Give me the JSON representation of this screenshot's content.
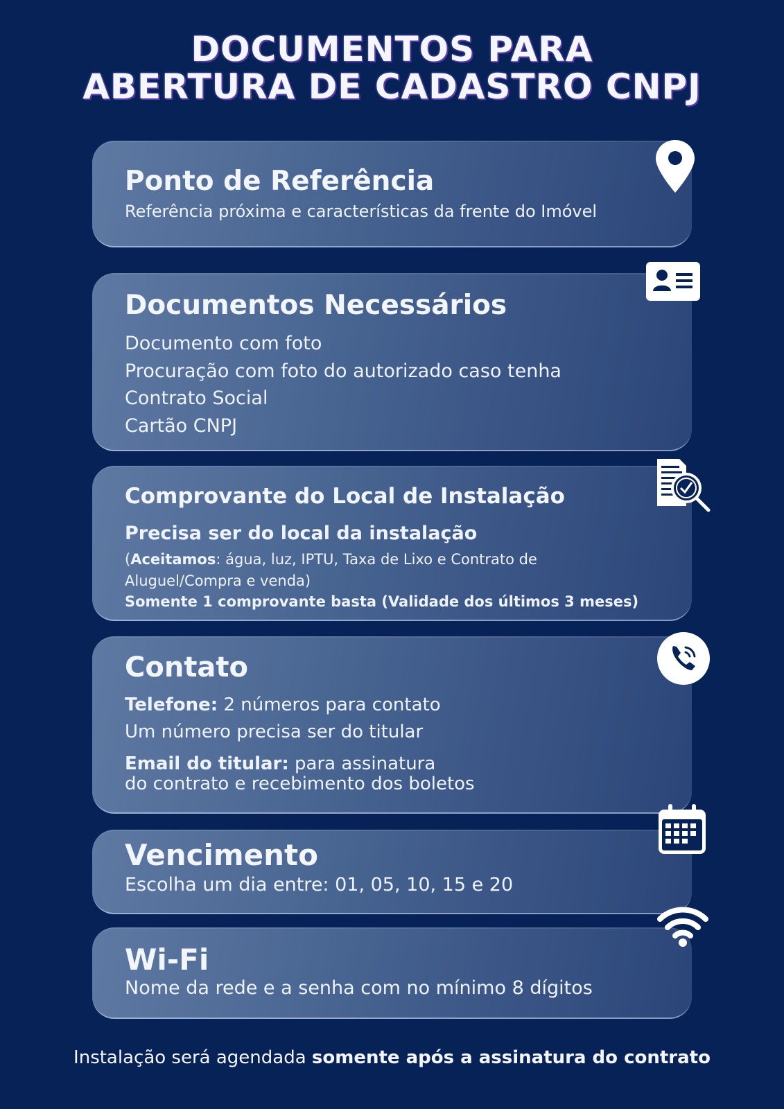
{
  "header": {
    "title_line1": "DOCUMENTOS PARA",
    "title_line2": "ABERTURA DE CADASTRO CNPJ"
  },
  "cards": {
    "referencia": {
      "title": "Ponto de Referência",
      "text": "Referência próxima e características da frente do Imóvel",
      "icon": "location-pin-icon"
    },
    "documentos": {
      "title": "Documentos Necessários",
      "items": [
        "Documento com foto",
        "Procuração com foto do autorizado caso tenha",
        "Contrato Social",
        "Cartão CNPJ"
      ],
      "icon": "id-card-icon"
    },
    "comprovante": {
      "title": "Comprovante do Local de Instalação",
      "subheading": "Precisa ser do local da instalação",
      "accept_label": "Aceitamos",
      "accept_text": ": água, luz, IPTU, Taxa de Lixo e Contrato de Aluguel/Compra e venda)",
      "open_paren": "(",
      "note": "Somente 1 comprovante basta (Validade dos últimos 3 meses)",
      "icon": "document-check-icon"
    },
    "contato": {
      "title": "Contato",
      "phone_label": "Telefone:",
      "phone_text": " 2 números para contato",
      "phone_line2": "Um número precisa ser do titular",
      "email_label": "Email do titular:",
      "email_text": " para assinatura",
      "email_line2": "do contrato e recebimento dos boletos",
      "icon": "phone-icon"
    },
    "vencimento": {
      "title": "Vencimento",
      "text": "Escolha um dia entre: 01, 05, 10, 15 e 20",
      "icon": "calendar-icon"
    },
    "wifi": {
      "title": "Wi-Fi",
      "text": "Nome da rede e a senha com no mínimo 8 dígitos",
      "icon": "wifi-icon"
    }
  },
  "footer": {
    "text_normal": "Instalação será agendada ",
    "text_bold": "somente após a assinatura do contrato"
  },
  "colors": {
    "background": "#062256",
    "card_light": "#5e7aa3",
    "card_dark": "#2b4579",
    "text": "#eef3fb",
    "title_shadow": "#5a3aa8"
  }
}
